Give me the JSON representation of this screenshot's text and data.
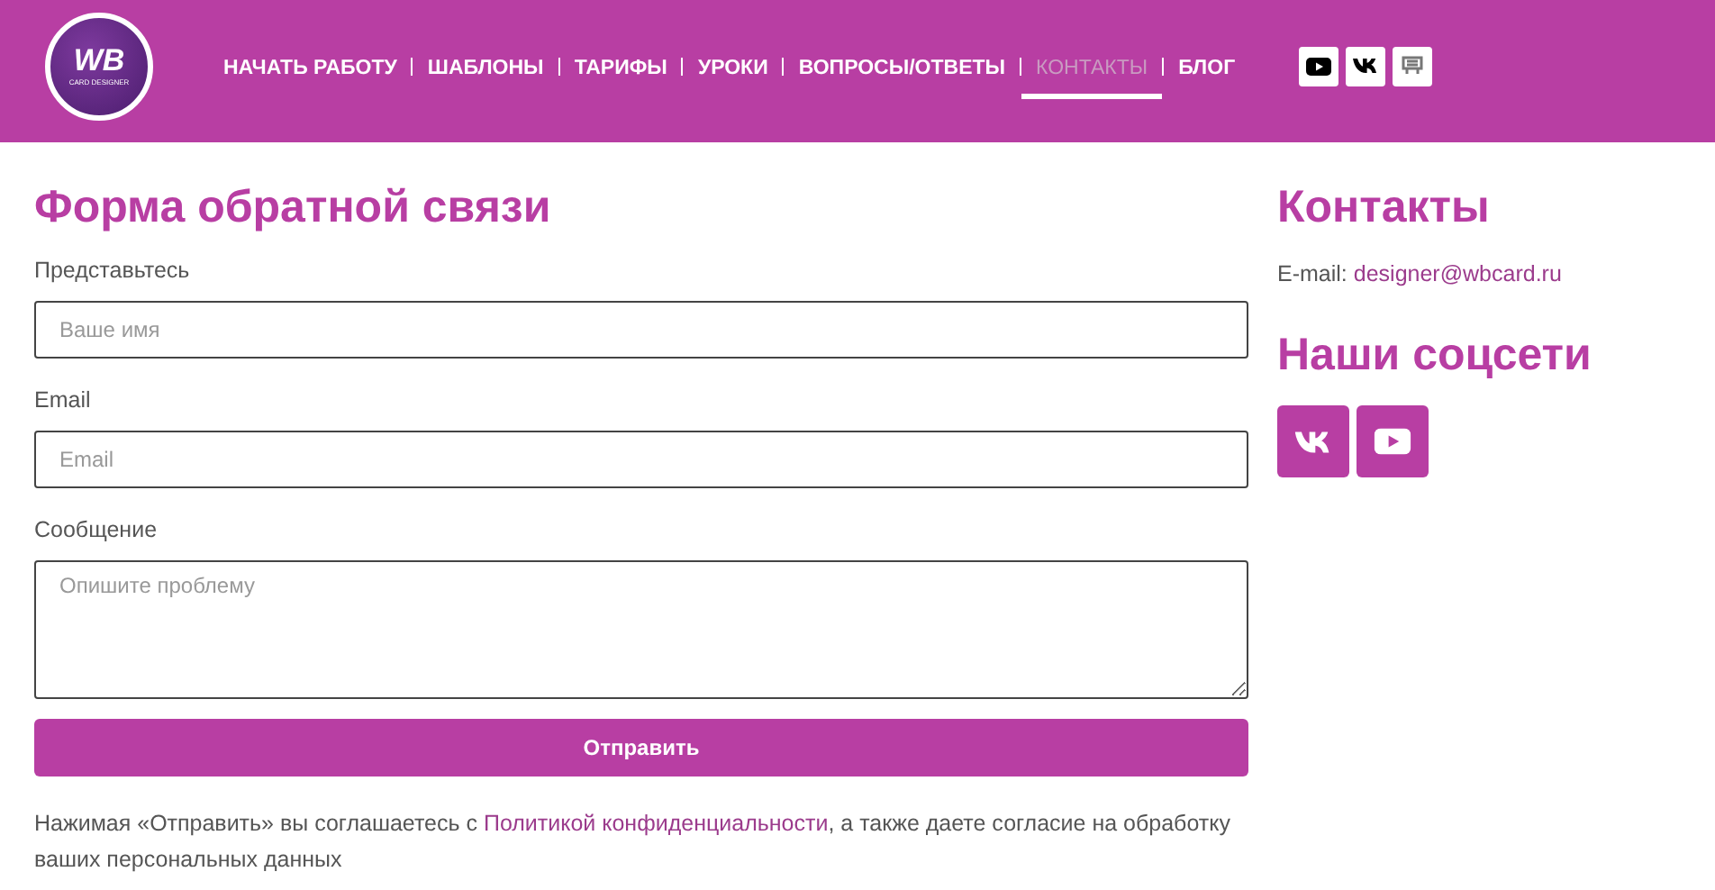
{
  "header": {
    "logo": {
      "mark": "WB",
      "subtitle": "CARD DESIGNER"
    },
    "nav": [
      {
        "label": "НАЧАТЬ РАБОТУ",
        "selected": false
      },
      {
        "label": "ШАБЛОНЫ",
        "selected": false
      },
      {
        "label": "ТАРИФЫ",
        "selected": false
      },
      {
        "label": "УРОКИ",
        "selected": false
      },
      {
        "label": "ВОПРОСЫ/ОТВЕТЫ",
        "selected": false
      },
      {
        "label": "КОНТАКТЫ",
        "selected": true
      },
      {
        "label": "БЛОГ",
        "selected": false
      }
    ],
    "social": [
      {
        "kind": "youtube"
      },
      {
        "kind": "vk"
      },
      {
        "kind": "store"
      }
    ]
  },
  "form": {
    "title": "Форма обратной связи",
    "fields": [
      {
        "label": "Представьтесь",
        "placeholder": "Ваше имя",
        "kind": "input"
      },
      {
        "label": "Email",
        "placeholder": "Email",
        "kind": "input"
      },
      {
        "label": "Сообщение",
        "placeholder": "Опишите проблему",
        "kind": "textarea"
      }
    ],
    "submit": "Отправить",
    "consent": {
      "before": "Нажимая «Отправить» вы соглашаетесь с ",
      "link": "Политикой конфиденциальности",
      "after": ", а также даете согласие на обработку ваших персональных данных"
    }
  },
  "contacts": {
    "title": "Контакты",
    "email_label": "E-mail:",
    "email": "designer@wbcard.ru",
    "social_title": "Наши соцсети",
    "social": [
      {
        "kind": "vk"
      },
      {
        "kind": "youtube"
      }
    ]
  }
}
